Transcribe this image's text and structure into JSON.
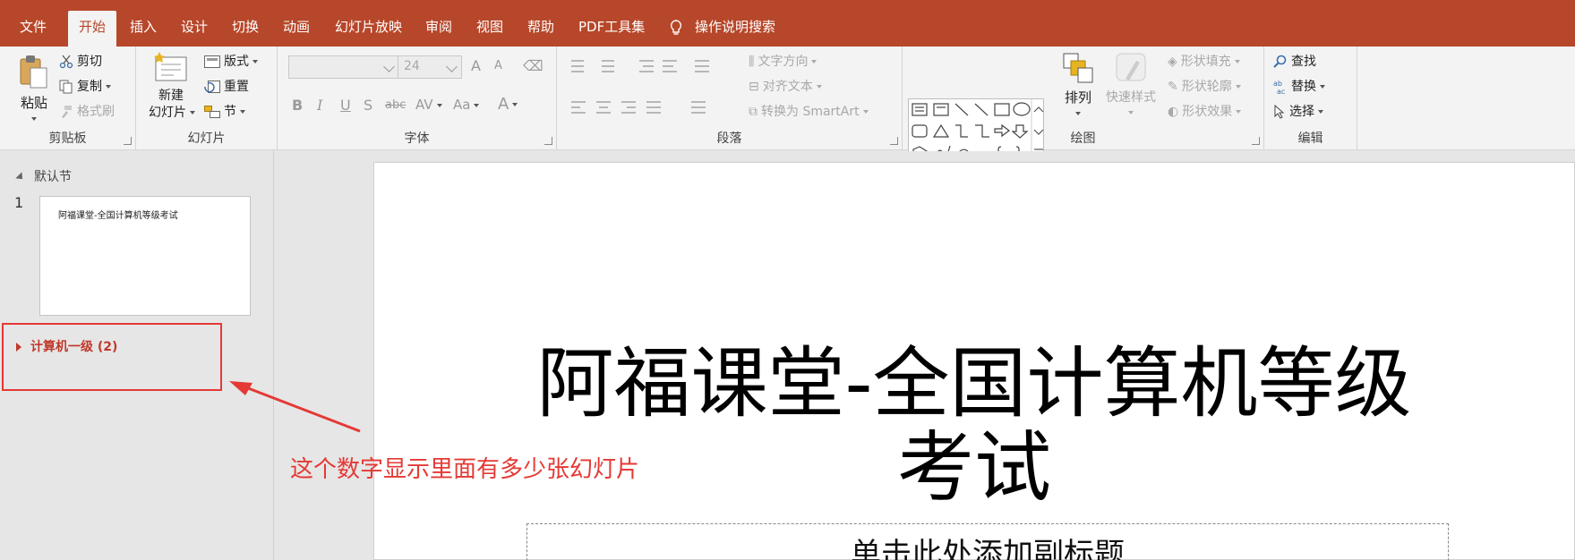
{
  "tabs": [
    "文件",
    "开始",
    "插入",
    "设计",
    "切换",
    "动画",
    "幻灯片放映",
    "审阅",
    "视图",
    "帮助",
    "PDF工具集"
  ],
  "active_tab": "开始",
  "tell_me": "操作说明搜索",
  "ribbon": {
    "clipboard": {
      "paste": "粘贴",
      "cut": "剪切",
      "copy": "复制",
      "format_painter": "格式刷",
      "label": "剪贴板"
    },
    "slides": {
      "new_slide_line1": "新建",
      "new_slide_line2": "幻灯片",
      "layout": "版式",
      "reset": "重置",
      "section": "节",
      "label": "幻灯片"
    },
    "font": {
      "font_size": "24",
      "bold": "B",
      "italic": "I",
      "underline": "U",
      "shadow": "S",
      "strike": "abc",
      "spacing": "AV",
      "case": "Aa",
      "color": "A",
      "grow": "A",
      "shrink": "A",
      "label": "字体"
    },
    "paragraph": {
      "text_direction": "文字方向",
      "align_text": "对齐文本",
      "smartart": "转换为 SmartArt",
      "label": "段落"
    },
    "drawing": {
      "arrange": "排列",
      "quick_styles": "快速样式",
      "shape_fill": "形状填充",
      "shape_outline": "形状轮廓",
      "shape_effects": "形状效果",
      "label": "绘图"
    },
    "editing": {
      "find": "查找",
      "replace": "替换",
      "select": "选择",
      "label": "编辑"
    }
  },
  "left_pane": {
    "default_section": "默认节",
    "slide_number": "1",
    "thumb_title": "阿福课堂-全国计算机等级考试",
    "section2": "计算机一级 (2)"
  },
  "slide": {
    "title": "阿福课堂-全国计算机等级考试",
    "subtitle": "单击此处添加副标题"
  },
  "annotation": "这个数字显示里面有多少张幻灯片",
  "colors": {
    "accent": "#b7472a",
    "annotation": "#e53935"
  }
}
